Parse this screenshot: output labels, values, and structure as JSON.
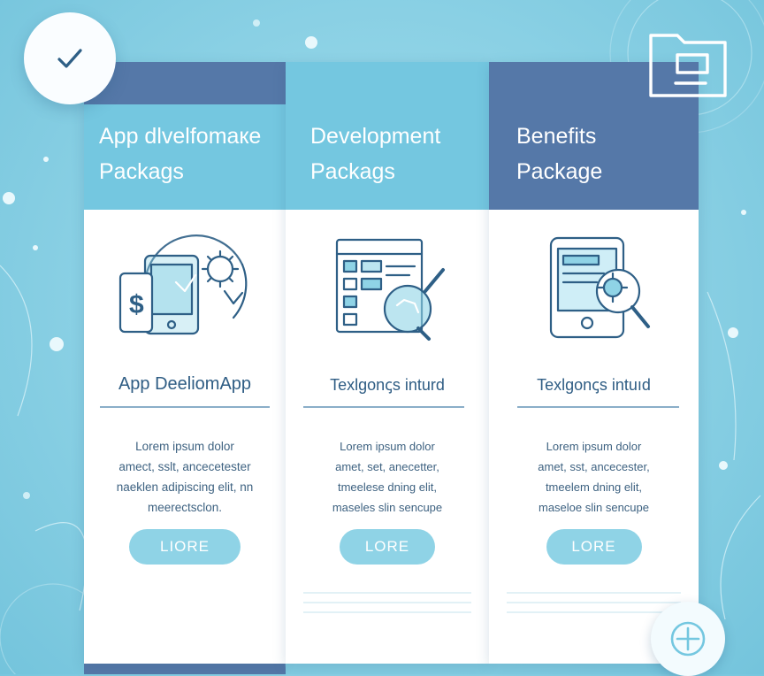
{
  "cards": [
    {
      "title_line1": "App dlvelfomaкe",
      "title_line2": "Packags",
      "illustration": "mobile-payment-gear-illustration",
      "subtitle": "App DeeliomApp",
      "body": "Lorem ipsum dolor\namect, sslt, ancecetester\nnaeklen adipiscing elit, nn\nmeerectsclon.",
      "button": "LIORE"
    },
    {
      "title_line1": "Development",
      "title_line2": "Packags",
      "illustration": "document-magnifier-illustration",
      "subtitle": "Texlgonꞔs inturd",
      "body": "Lorem ipsum dolor\namet, set, anecetter,\ntmeelese dning elit,\nmaseles slin sencupe",
      "button": "LORE"
    },
    {
      "title_line1": "Benefits",
      "title_line2": "Package",
      "illustration": "tablet-gear-magnifier-illustration",
      "subtitle": "Texlgonꞔs intuıd",
      "body": "Lorem ipsum dolor\namet, sst, ancecester,\ntmeelem dning elit,\nmaseloe slin sencupe",
      "button": "LORE"
    }
  ],
  "icons": {
    "check": "check-icon",
    "folder": "folder-icon",
    "plus": "plus-circle-icon"
  },
  "colors": {
    "background": "#8fd3e6",
    "header_light": "#74c7e0",
    "header_dark": "#5578a8",
    "button": "#8fd3e6",
    "text_dark": "#2f5d84",
    "icon_stroke": "#2e5f86"
  }
}
